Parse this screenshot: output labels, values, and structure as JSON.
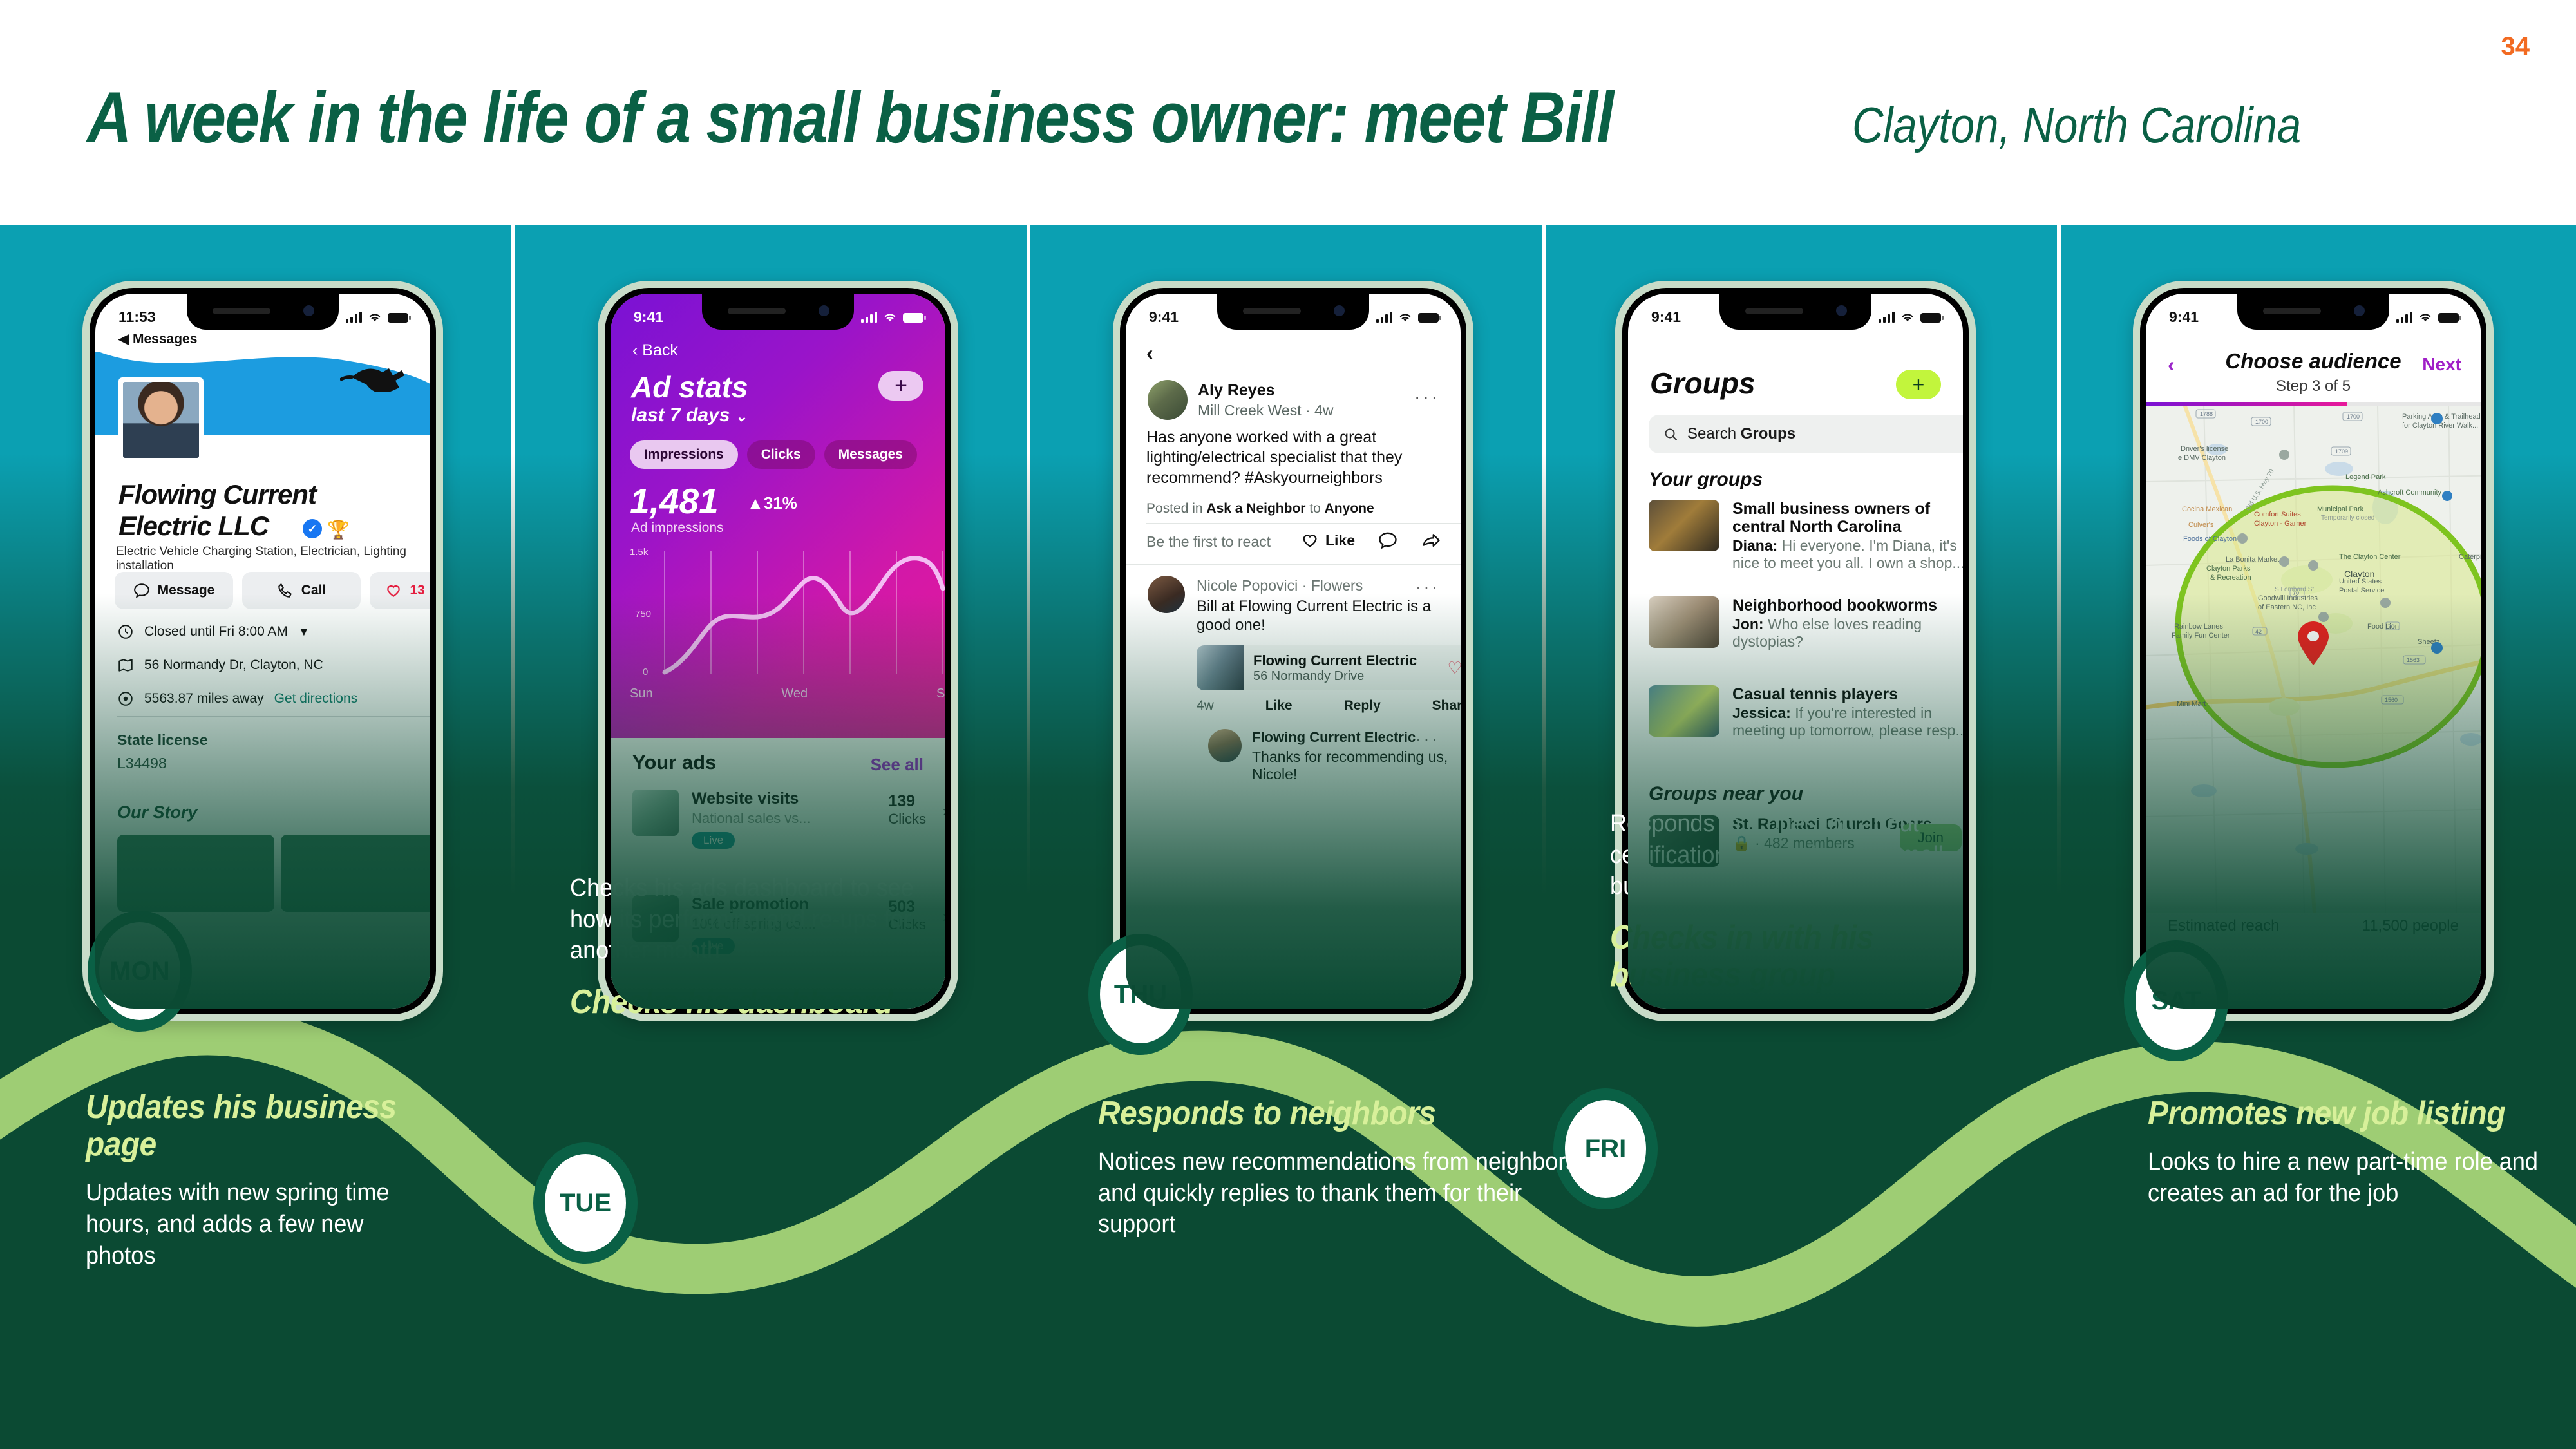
{
  "header": {
    "title_main": "A week in the life of a small business owner: meet Bill",
    "title_sub": "Clayton, North Carolina",
    "page_number": "34"
  },
  "colors": {
    "brand_green": "#0a6045",
    "deep_green": "#0b4a33",
    "teal": "#0ba0b2",
    "accent_lime": "#d8f09a",
    "wave_green": "#9ecd74",
    "page_number_orange": "#f26a21"
  },
  "phones": [
    {
      "id": "business-page",
      "status": {
        "time": "11:53",
        "back_label": "Messages"
      },
      "business_name": "Flowing Current\nElectric LLC",
      "categories": "Electric Vehicle Charging Station, Electrician, Lighting installation",
      "actions": [
        {
          "icon": "message-icon",
          "label": "Message"
        },
        {
          "icon": "phone-icon",
          "label": "Call"
        },
        {
          "icon": "heart-icon",
          "label": "13"
        }
      ],
      "info_rows": [
        {
          "icon": "clock-icon",
          "text": "Closed until Fri 8:00 AM",
          "chevron": true
        },
        {
          "icon": "map-icon",
          "text": "56 Normandy Dr, Clayton, NC"
        },
        {
          "icon": "location-icon",
          "text": "5563.87 miles away",
          "link": "Get directions"
        }
      ],
      "license_label": "State license",
      "license_value": "L34498",
      "story_heading": "Our Story"
    },
    {
      "id": "ad-stats",
      "status": {
        "time": "9:41"
      },
      "back_label": "Back",
      "title": "Ad stats",
      "subtitle": "last 7 days",
      "add_button": "+",
      "tabs": [
        "Impressions",
        "Clicks",
        "Messages"
      ],
      "active_tab": "Impressions",
      "metric_value": "1,481",
      "metric_delta": "31%",
      "metric_label": "Ad impressions",
      "list_heading": "Your ads",
      "see_all": "See all",
      "ads": [
        {
          "title": "Website visits",
          "subtitle": "National sales vs...",
          "badge": "Live",
          "count": "139",
          "unit": "Clicks"
        },
        {
          "title": "Sale promotion",
          "subtitle": "10% off spring col...",
          "badge": "Live",
          "count": "503",
          "unit": "Clicks"
        }
      ]
    },
    {
      "id": "neighbors-feed",
      "status": {
        "time": "9:41"
      },
      "post": {
        "author": "Aly Reyes",
        "meta": "Mill Creek West · 4w",
        "body": "Has anyone worked with a great lighting/electrical specialist that they recommend? #Askyourneighbors",
        "posted_in_prefix": "Posted in ",
        "posted_in_group": "Ask a Neighbor",
        "posted_to_prefix": " to ",
        "posted_to": "Anyone",
        "react_hint": "Be the first to react",
        "like_label": "Like"
      },
      "comment": {
        "author": "Nicole Popovici",
        "author_meta": " · Flowers",
        "body": "Bill at Flowing Current Electric is a good one!",
        "card_title": "Flowing Current Electric",
        "card_sub": "56 Normandy Drive",
        "time": "4w",
        "actions": [
          "Like",
          "Reply",
          "Share"
        ]
      },
      "reply": {
        "author": "Flowing Current Electric",
        "body": "Thanks for recommending us, Nicole!"
      }
    },
    {
      "id": "groups",
      "status": {
        "time": "9:41"
      },
      "title": "Groups",
      "add_button": "+",
      "search_placeholder_prefix": "Search ",
      "search_placeholder_bold": "Groups",
      "section_your": "Your groups",
      "section_near": "Groups near you",
      "your_groups": [
        {
          "name": "Small business owners of central North Carolina",
          "preview_author": "Diana:",
          "preview": " Hi everyone. I'm Diana, it's nice to meet you all. I own a shop..."
        },
        {
          "name": "Neighborhood bookworms",
          "preview_author": "Jon:",
          "preview": " Who else loves reading dystopias?"
        },
        {
          "name": "Casual tennis players",
          "preview_author": "Jessica:",
          "preview": " If you're interested in meeting up tomorrow, please resp..."
        }
      ],
      "near_groups": [
        {
          "name": "St. Raphael Church Goers",
          "members": "· 482 members",
          "join_label": "Join"
        }
      ]
    },
    {
      "id": "choose-audience",
      "status": {
        "time": "9:41"
      },
      "title": "Choose audience",
      "step": "Step 3 of 5",
      "next_label": "Next",
      "reach_label": "Estimated reach",
      "reach_value": "11,500 people",
      "map_labels": [
        "Parking Area & Trailhead for Clayton River Walk...",
        "Driver's license e DMV Clayton",
        "Legend Park",
        "Ashcroft Community",
        "Municipal Park",
        "Temporarily closed",
        "Cocina Mexican",
        "Culver's",
        "Comfort Suites Clayton - Garner",
        "Foods of Clayton",
        "La Bonita Market",
        "The Clayton Center",
        "Clayton",
        "Clayton Parks & Recreation",
        "United States Postal Service",
        "Goodwill Industries of Eastern NC, Inc",
        "Food Lion",
        "Sheetz",
        "Rainbow Lanes Family Fun Center",
        "Mini Mart",
        "Caterpillar CMD"
      ]
    }
  ],
  "timeline": [
    {
      "day": "MON",
      "heading": "Updates his business page",
      "body": "Updates with new spring time hours, and adds a few new photos",
      "order": "heading_first"
    },
    {
      "day": "TUE",
      "heading": "Checks his dashboard",
      "body": "Checks his ads dashboard to see how its performing and re-ups for another month",
      "order": "body_first"
    },
    {
      "day": "THU",
      "heading": "Responds to neighbors",
      "body": "Notices new recommendations from neighbors and quickly replies to thank them for their support",
      "order": "heading_first"
    },
    {
      "day": "FRI",
      "heading": "Checks in with his business group",
      "body": "Responds to a question about certifications from his local small business owner group",
      "order": "body_first"
    },
    {
      "day": "SAT",
      "heading": "Promotes new job listing",
      "body": "Looks to hire a new part-time role and creates an ad for the job",
      "order": "heading_first"
    }
  ]
}
